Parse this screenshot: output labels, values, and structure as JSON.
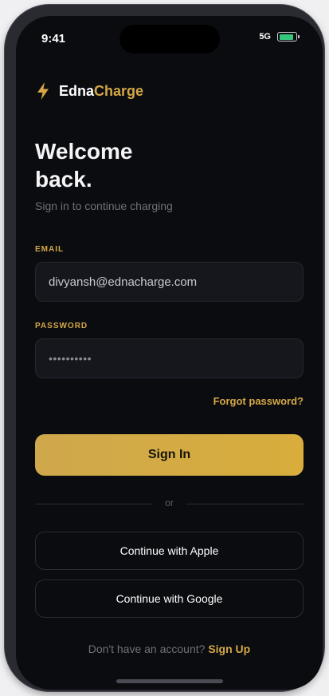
{
  "status_bar": {
    "time": "9:41",
    "signal": "5G",
    "battery_level": 0.85,
    "battery_color": "#34c77b"
  },
  "brand": {
    "name_part1": "Edna",
    "name_part2": "Charge",
    "logo_icon": "lightning-bolt-icon",
    "accent_color": "#d4a846"
  },
  "header": {
    "title": "Welcome back.",
    "subtitle": "Sign in to continue charging"
  },
  "form": {
    "email_label": "EMAIL",
    "email_value": "divyansh@ednacharge.com",
    "password_label": "PASSWORD",
    "password_value": "••••••••••",
    "forgot_label": "Forgot password?",
    "submit_label": "Sign In"
  },
  "divider": {
    "label": "or"
  },
  "social": {
    "apple_label": "Continue with Apple",
    "google_label": "Continue with Google"
  },
  "footer": {
    "prompt": "Don't have an account?",
    "link": "Sign Up"
  }
}
